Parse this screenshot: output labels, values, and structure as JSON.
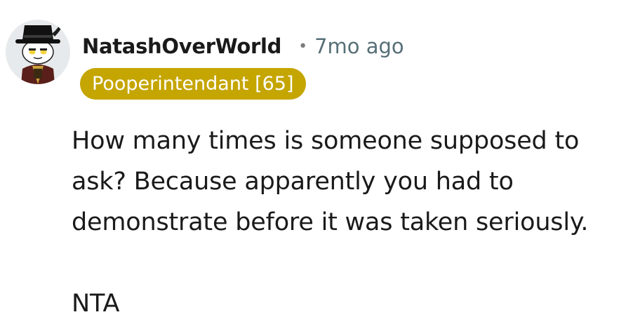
{
  "comment": {
    "author": {
      "username": "NatashOverWorld",
      "avatar_icon": "snoo-avatar-icon",
      "flair": "Pooperintendant [65]",
      "flair_color": "#c5a500"
    },
    "separator": "•",
    "timestamp": "7mo ago",
    "body": {
      "paragraph_1": "How many times is someone supposed to ask? Because apparently you had to demonstrate before it was taken seriously.",
      "paragraph_2": "NTA"
    }
  }
}
